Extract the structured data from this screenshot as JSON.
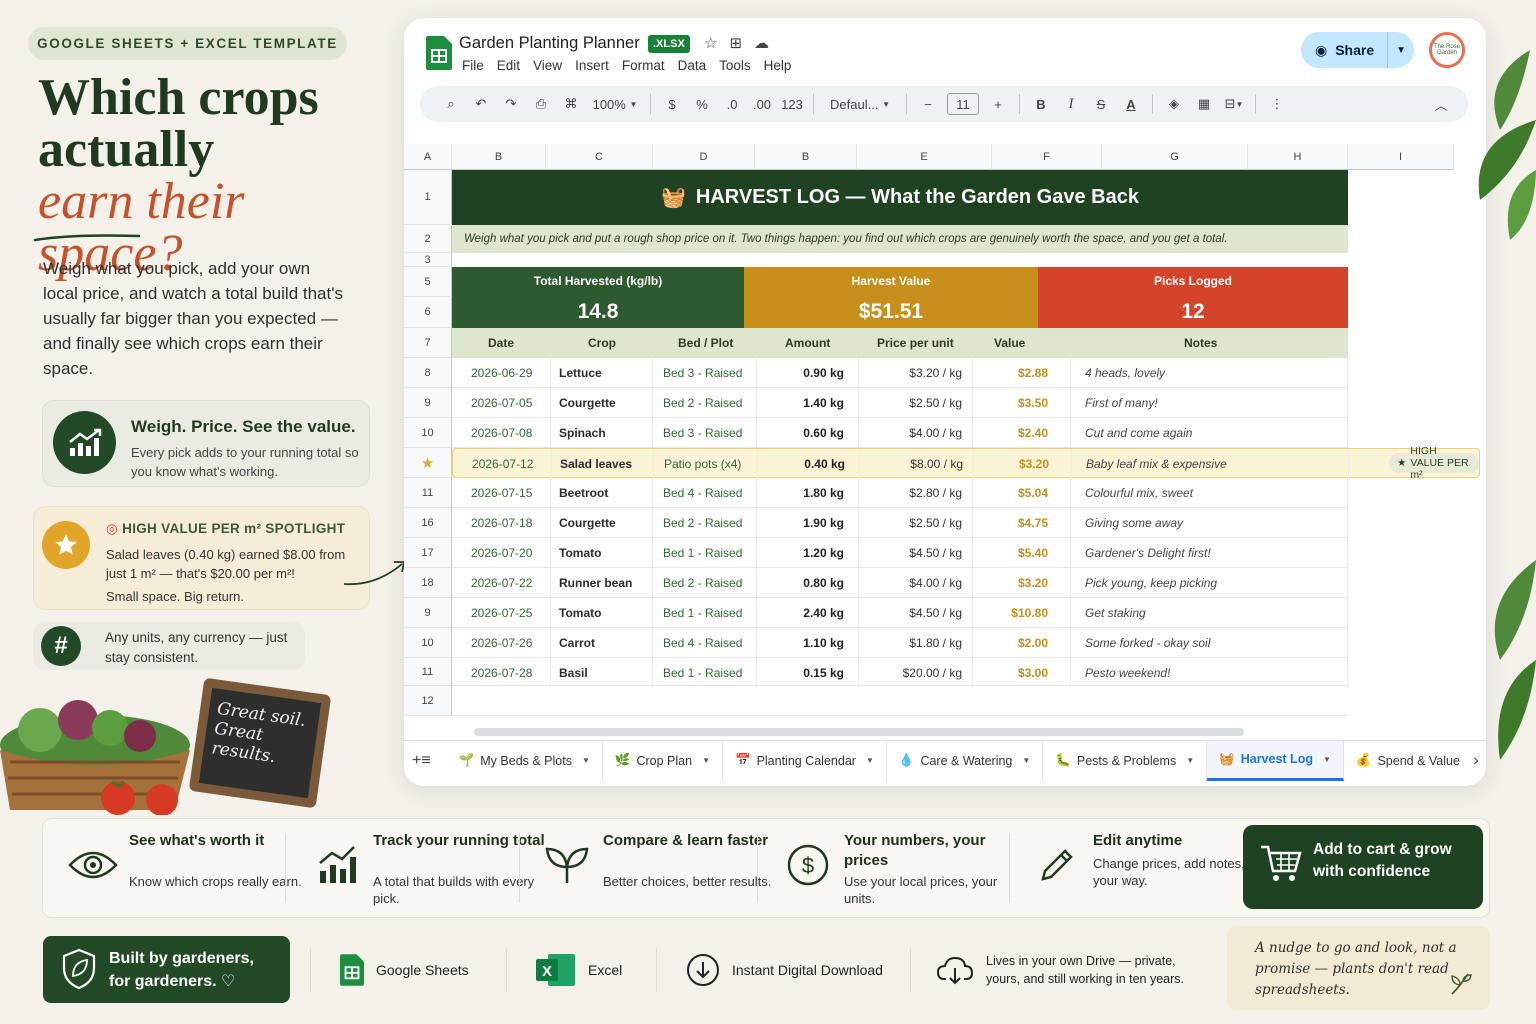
{
  "hero": {
    "tag": "GOOGLE SHEETS + EXCEL TEMPLATE",
    "title_line1": "Which crops",
    "title_line2": "actually",
    "title_line3": "earn their space?",
    "subtitle": "Weigh what you pick, add your own local price, and watch a total build that's usually far bigger than you expected — and finally see which crops earn their space."
  },
  "card_weigh": {
    "title": "Weigh. Price. See the value.",
    "text": "Every pick adds to your running total so you know what's working."
  },
  "card_spotlight": {
    "title": "HIGH VALUE PER m² SPOTLIGHT",
    "text": "Salad leaves (0.40 kg) earned $8.00 from just 1 m² — that's $20.00 per m²!",
    "tagline": "Small space. Big return."
  },
  "card_units": {
    "text": "Any units, any currency — just stay consistent."
  },
  "chalkboard": {
    "text": "Great soil. Great results."
  },
  "sheet": {
    "doc_title": "Garden Planting Planner",
    "file_badge": ".XLSX",
    "menu": [
      "File",
      "Edit",
      "View",
      "Insert",
      "Format",
      "Data",
      "Tools",
      "Help"
    ],
    "share_label": "Share",
    "avatar_text": "The Rose Garden",
    "toolbar": {
      "zoom": "100%",
      "currency": "$",
      "percent": "%",
      "dec_less": ".0",
      "dec_more": ".00",
      "number_fmt": "123",
      "font": "Defaul...",
      "font_size": "11",
      "bold": "B",
      "italic": "I"
    },
    "columns": [
      "A",
      "B",
      "C",
      "D",
      "B",
      "E",
      "F",
      "G",
      "H",
      "I"
    ],
    "row_numbers": [
      "1",
      "2",
      "3",
      "5",
      "6",
      "7",
      "8",
      "9",
      "10",
      "★",
      "11",
      "16",
      "17",
      "18",
      "9",
      "10",
      "11",
      "12"
    ],
    "banner_title": "HARVEST LOG — What the Garden Gave Back",
    "intro": "Weigh what you pick and put a rough shop price on it. Two things happen: you find out which crops are genuinely worth the space, and you get a total.",
    "kpis": [
      {
        "label": "Total Harvested (kg/lb)",
        "value": "14.8"
      },
      {
        "label": "Harvest Value",
        "value": "$51.51"
      },
      {
        "label": "Picks Logged",
        "value": "12"
      }
    ],
    "headers": [
      "Date",
      "Crop",
      "Bed / Plot",
      "Amount",
      "Price per unit",
      "Value",
      "Notes"
    ],
    "rows": [
      {
        "date": "2026-06-29",
        "crop": "Lettuce",
        "bed": "Bed 3 - Raised",
        "amount": "0.90 kg",
        "price": "$3.20 / kg",
        "value": "$2.88",
        "notes": "4 heads, lovely"
      },
      {
        "date": "2026-07-05",
        "crop": "Courgette",
        "bed": "Bed 2 - Raised",
        "amount": "1.40 kg",
        "price": "$2.50 / kg",
        "value": "$3.50",
        "notes": "First of many!"
      },
      {
        "date": "2026-07-08",
        "crop": "Spinach",
        "bed": "Bed 3 - Raised",
        "amount": "0.60 kg",
        "price": "$4.00 / kg",
        "value": "$2.40",
        "notes": "Cut and come again"
      },
      {
        "date": "2026-07-12",
        "crop": "Salad leaves",
        "bed": "Patio pots (x4)",
        "amount": "0.40 kg",
        "price": "$8.00 / kg",
        "value": "$3.20",
        "notes": "Baby leaf mix & expensive"
      },
      {
        "date": "2026-07-15",
        "crop": "Beetroot",
        "bed": "Bed 4 - Raised",
        "amount": "1.80 kg",
        "price": "$2.80 / kg",
        "value": "$5.04",
        "notes": "Colourful mix, sweet"
      },
      {
        "date": "2026-07-18",
        "crop": "Courgette",
        "bed": "Bed 2 - Raised",
        "amount": "1.90 kg",
        "price": "$2.50 / kg",
        "value": "$4.75",
        "notes": "Giving some away"
      },
      {
        "date": "2026-07-20",
        "crop": "Tomato",
        "bed": "Bed 1 - Raised",
        "amount": "1.20 kg",
        "price": "$4.50 / kg",
        "value": "$5.40",
        "notes": "Gardener's Delight first!"
      },
      {
        "date": "2026-07-22",
        "crop": "Runner bean",
        "bed": "Bed 2 - Raised",
        "amount": "0.80 kg",
        "price": "$4.00 / kg",
        "value": "$3.20",
        "notes": "Pick young, keep picking"
      },
      {
        "date": "2026-07-25",
        "crop": "Tomato",
        "bed": "Bed 1 - Raised",
        "amount": "2.40 kg",
        "price": "$4.50 / kg",
        "value": "$10.80",
        "notes": "Get staking"
      },
      {
        "date": "2026-07-26",
        "crop": "Carrot",
        "bed": "Bed 4 - Raised",
        "amount": "1.10 kg",
        "price": "$1.80 / kg",
        "value": "$2.00",
        "notes": "Some forked - okay soil"
      },
      {
        "date": "2026-07-28",
        "crop": "Basil",
        "bed": "Bed 1 - Raised",
        "amount": "0.15 kg",
        "price": "$20.00 / kg",
        "value": "$3.00",
        "notes": "Pesto weekend!"
      }
    ],
    "highlight_badge": "HIGH VALUE PER m²",
    "tabs": [
      "My Beds & Plots",
      "Crop Plan",
      "Planting Calendar",
      "Care & Watering",
      "Pests & Problems",
      "Harvest Log",
      "Spend & Value"
    ],
    "active_tab": "Harvest Log"
  },
  "features": [
    {
      "title": "See what's worth it",
      "text": "Know which crops really earn."
    },
    {
      "title": "Track your running total",
      "text": "A total that builds with every pick."
    },
    {
      "title": "Compare & learn faster",
      "text": "Better choices, better results."
    },
    {
      "title": "Your numbers, your prices",
      "text": "Use your local prices, your units."
    },
    {
      "title": "Edit anytime",
      "text": "Change prices, add notes, your way."
    }
  ],
  "cart_button": "Add to cart & grow with confidence",
  "built_badge": "Built by gardeners, for gardeners. ♡",
  "trust": {
    "sheets": "Google Sheets",
    "excel": "Excel",
    "download": "Instant Digital Download",
    "drive": "Lives in your own Drive — private, yours, and still working in ten years."
  },
  "nudge": "A nudge to go and look, not a promise — plants don't read spreadsheets.",
  "colors": {
    "forest": "#1f4322",
    "gold": "#c58f1a",
    "red": "#d5432a",
    "accent": "#c7512b",
    "link_blue": "#1a73e8"
  }
}
